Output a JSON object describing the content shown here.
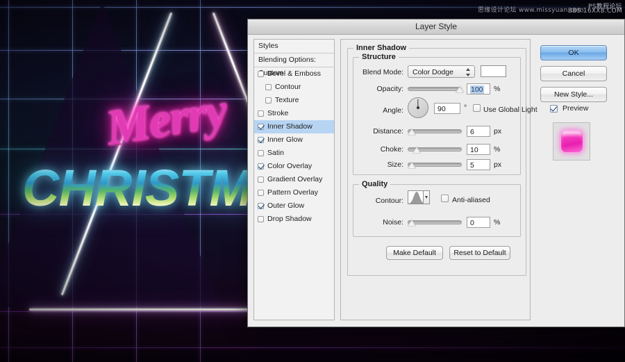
{
  "watermark": {
    "line_a": "思缘设计论坛   www.missyuan.com",
    "line_b": "PS教程论坛",
    "line_c": "BBS.16XX8.COM"
  },
  "artwork": {
    "script_text": "Merry",
    "block_text": "CHRISTMAS",
    "neon_pink": "#e23ab4",
    "neon_cyan": "#4fc8e8",
    "grid_purple": "#9b4fd8"
  },
  "dialog": {
    "title": "Layer Style"
  },
  "styles_panel": {
    "header": "Styles",
    "blending_options": "Blending Options: Custom",
    "items": [
      {
        "label": "Bevel & Emboss",
        "checked": false,
        "selected": false,
        "indent": false
      },
      {
        "label": "Contour",
        "checked": false,
        "selected": false,
        "indent": true
      },
      {
        "label": "Texture",
        "checked": false,
        "selected": false,
        "indent": true
      },
      {
        "label": "Stroke",
        "checked": false,
        "selected": false,
        "indent": false
      },
      {
        "label": "Inner Shadow",
        "checked": true,
        "selected": true,
        "indent": false
      },
      {
        "label": "Inner Glow",
        "checked": true,
        "selected": false,
        "indent": false
      },
      {
        "label": "Satin",
        "checked": false,
        "selected": false,
        "indent": false
      },
      {
        "label": "Color Overlay",
        "checked": true,
        "selected": false,
        "indent": false
      },
      {
        "label": "Gradient Overlay",
        "checked": false,
        "selected": false,
        "indent": false
      },
      {
        "label": "Pattern Overlay",
        "checked": false,
        "selected": false,
        "indent": false
      },
      {
        "label": "Outer Glow",
        "checked": true,
        "selected": false,
        "indent": false
      },
      {
        "label": "Drop Shadow",
        "checked": false,
        "selected": false,
        "indent": false
      }
    ]
  },
  "effect": {
    "group_title": "Inner Shadow",
    "structure": {
      "title": "Structure",
      "blend_mode_label": "Blend Mode:",
      "blend_mode_value": "Color Dodge",
      "blend_color": "#ffffff",
      "opacity_label": "Opacity:",
      "opacity_value": "100",
      "opacity_unit": "%",
      "angle_label": "Angle:",
      "angle_value": "90",
      "angle_unit": "°",
      "use_global_light_label": "Use Global Light",
      "use_global_light_checked": false,
      "distance_label": "Distance:",
      "distance_value": "6",
      "distance_unit": "px",
      "choke_label": "Choke:",
      "choke_value": "10",
      "choke_unit": "%",
      "size_label": "Size:",
      "size_value": "5",
      "size_unit": "px"
    },
    "quality": {
      "title": "Quality",
      "contour_label": "Contour:",
      "anti_aliased_label": "Anti-aliased",
      "anti_aliased_checked": false,
      "noise_label": "Noise:",
      "noise_value": "0",
      "noise_unit": "%"
    },
    "make_default": "Make Default",
    "reset_to_default": "Reset to Default"
  },
  "buttons": {
    "ok": "OK",
    "cancel": "Cancel",
    "new_style": "New Style...",
    "preview_label": "Preview",
    "preview_checked": true
  }
}
